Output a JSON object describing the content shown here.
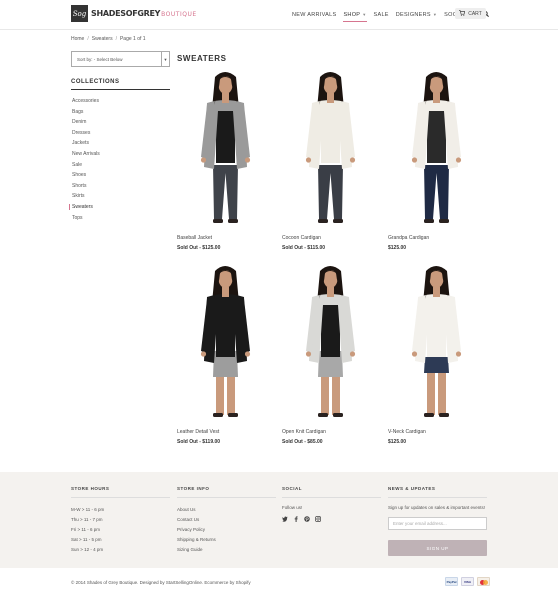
{
  "brand": {
    "logo_mark": "Sog",
    "name": "SHADESOFGREY",
    "suffix": "BOUTIQUE",
    "accent_color": "#d6758f"
  },
  "nav": {
    "items": [
      {
        "label": "NEW ARRIVALS",
        "dropdown": false
      },
      {
        "label": "SHOP",
        "dropdown": true
      },
      {
        "label": "SALE",
        "dropdown": false
      },
      {
        "label": "DESIGNERS",
        "dropdown": true
      },
      {
        "label": "SOG",
        "dropdown": true
      }
    ],
    "cart_label": "CART",
    "icons": [
      "user-icon",
      "search-icon",
      "cart-icon"
    ]
  },
  "breadcrumb": [
    "Home",
    "Sweaters",
    "Page 1 of 1"
  ],
  "sort": {
    "value": "Sort by: - Select Below"
  },
  "sidebar": {
    "title": "COLLECTIONS",
    "items": [
      "Accessories",
      "Bags",
      "Denim",
      "Dresses",
      "Jackets",
      "New Arrivals",
      "Sale",
      "Shoes",
      "Shorts",
      "Skirts",
      "Sweaters",
      "Tops"
    ],
    "active": "Sweaters"
  },
  "main": {
    "title": "SWEATERS",
    "products": [
      {
        "name": "Baseball Jacket",
        "price": "Sold Out - $125.00",
        "top_color": "#9a9a9a",
        "inner_color": "#1a1a1a",
        "bottom_color": "#3f434a",
        "bottom": "pants"
      },
      {
        "name": "Cocoon Cardigan",
        "price": "Sold Out - $115.00",
        "top_color": "#efece4",
        "inner_color": "#efece4",
        "bottom_color": "#3a3e46",
        "bottom": "pants"
      },
      {
        "name": "Grandpa Cardigan",
        "price": "$125.00",
        "top_color": "#f1eee8",
        "inner_color": "#2a2a2a",
        "bottom_color": "#1f2a44",
        "bottom": "pants"
      },
      {
        "name": "Leather Detail Vest",
        "price": "Sold Out - $119.00",
        "top_color": "#1a1a1a",
        "inner_color": "#1a1a1a",
        "bottom_color": "#9d9d9d",
        "bottom": "skirt"
      },
      {
        "name": "Open Knit Cardigan",
        "price": "Sold Out - $85.00",
        "top_color": "#d9d9d6",
        "inner_color": "#1a1a1a",
        "bottom_color": "#a8a8a8",
        "bottom": "skirt"
      },
      {
        "name": "V-Neck Cardigan",
        "price": "$125.00",
        "top_color": "#f3f1ec",
        "inner_color": "#f3f1ec",
        "bottom_color": "#2d3a55",
        "bottom": "shorts"
      }
    ]
  },
  "footer": {
    "store_hours": {
      "title": "STORE HOURS",
      "lines": [
        "M-W > 11 - 6 pm",
        "Thu > 11 - 7 pm",
        "Fri > 11 - 6 pm",
        "Sat > 11 - 5 pm",
        "Sun > 12 - 4 pm"
      ]
    },
    "store_info": {
      "title": "STORE INFO",
      "links": [
        "About Us",
        "Contact Us",
        "Privacy Policy",
        "Shipping & Returns",
        "Sizing Guide"
      ]
    },
    "social": {
      "title": "SOCIAL",
      "text": "Follow us!",
      "icons": [
        "twitter-icon",
        "facebook-icon",
        "pinterest-icon",
        "instagram-icon"
      ]
    },
    "news": {
      "title": "NEWS & UPDATES",
      "text": "Sign up for updates on sales & important events!",
      "placeholder": "Enter your email address...",
      "button": "SIGN UP"
    }
  },
  "copyright": "© 2014 Shades of Grey Boutique. Designed by StartSellingOnline. Ecommerce by Shopify",
  "payments": [
    "PayPal",
    "VISA",
    "mastercard"
  ]
}
